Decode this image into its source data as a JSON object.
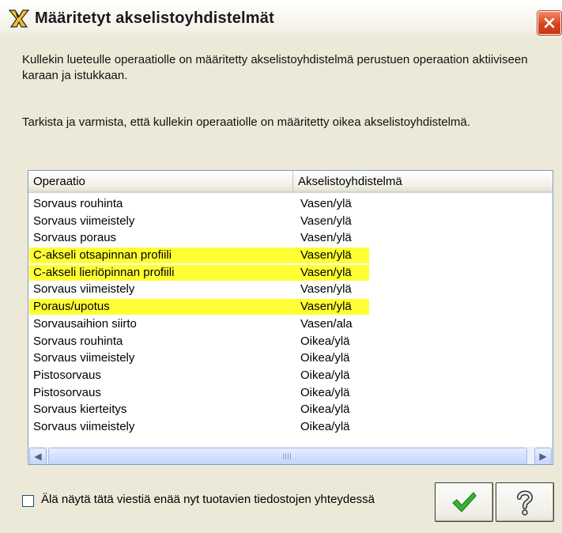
{
  "window": {
    "title": "Määritetyt akselistoyhdistelmät",
    "close_glyph": "✕"
  },
  "message": {
    "line1": "Kullekin lueteulle operaatiolle on määritetty akselistoyhdistelmä perustuen operaation aktiiviseen karaan ja istukkaan.",
    "line2": "Tarkista ja varmista, että kullekin operaatiolle on määritetty oikea akselistoyhdistelmä."
  },
  "table": {
    "columns": [
      "Operaatio",
      "Akselistoyhdistelmä"
    ],
    "rows": [
      {
        "op": "Sorvaus rouhinta",
        "axis": "Vasen/ylä",
        "highlight": false
      },
      {
        "op": "Sorvaus viimeistely",
        "axis": "Vasen/ylä",
        "highlight": false
      },
      {
        "op": "Sorvaus poraus",
        "axis": "Vasen/ylä",
        "highlight": false
      },
      {
        "op": "C-akseli otsapinnan profiili",
        "axis": "Vasen/ylä",
        "highlight": true
      },
      {
        "op": "C-akseli lieriöpinnan profiili",
        "axis": "Vasen/ylä",
        "highlight": true
      },
      {
        "op": "Sorvaus viimeistely",
        "axis": "Vasen/ylä",
        "highlight": false
      },
      {
        "op": "Poraus/upotus",
        "axis": "Vasen/ylä",
        "highlight": true
      },
      {
        "op": "Sorvausaihion siirto",
        "axis": "Vasen/ala",
        "highlight": false
      },
      {
        "op": "Sorvaus rouhinta",
        "axis": "Oikea/ylä",
        "highlight": false
      },
      {
        "op": "Sorvaus viimeistely",
        "axis": "Oikea/ylä",
        "highlight": false
      },
      {
        "op": "Pistosorvaus",
        "axis": "Oikea/ylä",
        "highlight": false
      },
      {
        "op": "Pistosorvaus",
        "axis": "Oikea/ylä",
        "highlight": false
      },
      {
        "op": "Sorvaus kierteitys",
        "axis": "Oikea/ylä",
        "highlight": false
      },
      {
        "op": "Sorvaus viimeistely",
        "axis": "Oikea/ylä",
        "highlight": false
      }
    ],
    "highlight_color": "#ffff33"
  },
  "scrollbar": {
    "left_glyph": "◀",
    "right_glyph": "▶"
  },
  "footer": {
    "checkbox_label": "Älä näytä tätä viestiä enää nyt tuotavien tiedostojen yhteydessä",
    "checkbox_checked": false,
    "ok_icon": "checkmark-icon",
    "help_icon": "question-icon"
  },
  "colors": {
    "title_accent": "#2b2b2b",
    "close_red": "#d8441f",
    "ok_green": "#2ea82e"
  }
}
